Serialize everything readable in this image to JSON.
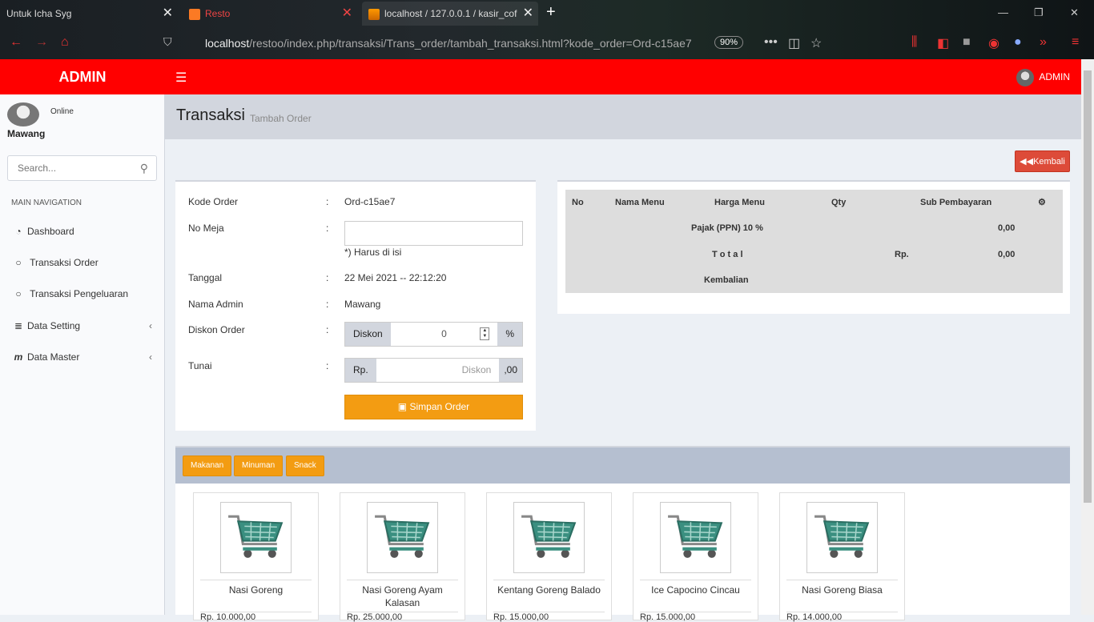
{
  "browser": {
    "tabs": [
      {
        "title": "Untuk Icha Syg"
      },
      {
        "title": "Resto"
      },
      {
        "title": "localhost / 127.0.0.1 / kasir_cof"
      }
    ],
    "url_host": "localhost",
    "url_path": "/restoo/index.php/transaksi/Trans_order/tambah_transaksi.html?kode_order=Ord-c15ae7",
    "zoom": "90%"
  },
  "header": {
    "brand": "ADMIN",
    "user": "ADMIN"
  },
  "sidebar": {
    "user_name": "Mawang",
    "status": "Online",
    "search_placeholder": "Search...",
    "nav_title": "MAIN NAVIGATION",
    "items": [
      {
        "label": "Dashboard",
        "icon": "dashboard-icon"
      },
      {
        "label": "Transaksi Order",
        "icon": "circle-icon"
      },
      {
        "label": "Transaksi Pengeluaran",
        "icon": "circle-icon"
      },
      {
        "label": "Data Setting",
        "icon": "database-icon"
      },
      {
        "label": "Data Master",
        "icon": "master-icon"
      }
    ]
  },
  "content": {
    "title": "Transaksi",
    "subtitle": "Tambah Order",
    "back_button": "Kembali"
  },
  "form": {
    "kode_order_label": "Kode Order",
    "kode_order_value": "Ord-c15ae7",
    "no_meja_label": "No Meja",
    "no_meja_value": "",
    "no_meja_hint": "*) Harus di isi",
    "tanggal_label": "Tanggal",
    "tanggal_value": "22 Mei 2021 -- 22:12:20",
    "admin_label": "Nama Admin",
    "admin_value": "Mawang",
    "diskon_label": "Diskon Order",
    "diskon_addon": "Diskon",
    "diskon_value": "0",
    "diskon_unit": "%",
    "tunai_label": "Tunai",
    "tunai_prefix": "Rp.",
    "tunai_placeholder": "Diskon",
    "tunai_suffix": ",00",
    "save_button": "Simpan Order",
    "colon": ":"
  },
  "order_table": {
    "headers": [
      "No",
      "Nama Menu",
      "Harga Menu",
      "Qty",
      "Sub Pembayaran"
    ],
    "pajak_label": "Pajak (PPN) 10 %",
    "pajak_value": "0,00",
    "total_label": "T o t a l",
    "total_currency": "Rp.",
    "total_value": "0,00",
    "kembalian_label": "Kembalian"
  },
  "menu": {
    "categories": [
      "Makanan",
      "Minuman",
      "Snack"
    ],
    "items": [
      {
        "name": "Nasi Goreng",
        "price": "Rp. 10.000,00"
      },
      {
        "name": "Nasi Goreng Ayam Kalasan",
        "price": "Rp. 25.000,00"
      },
      {
        "name": "Kentang Goreng Balado",
        "price": "Rp. 15.000,00"
      },
      {
        "name": "Ice Capocino Cincau",
        "price": "Rp. 15.000,00"
      },
      {
        "name": "Nasi Goreng Biasa",
        "price": "Rp. 14.000,00"
      }
    ]
  },
  "colors": {
    "accent": "#ff0000",
    "warning": "#f39c12",
    "danger": "#dd4b39"
  }
}
